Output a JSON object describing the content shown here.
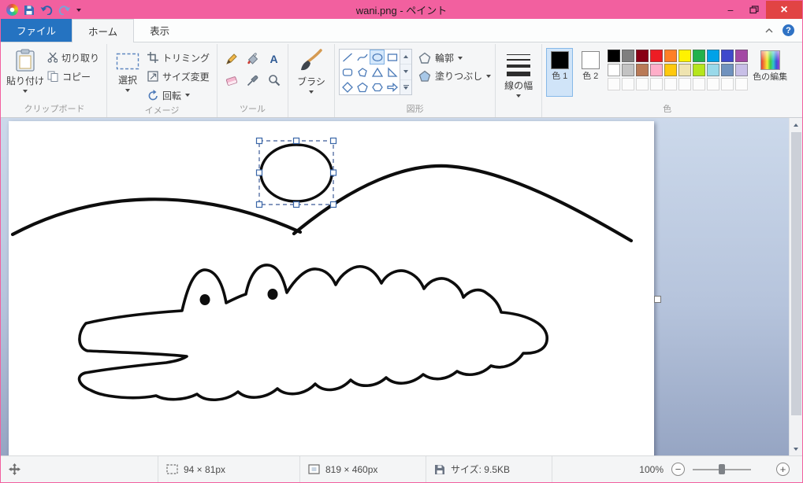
{
  "theme": {
    "titlebar_color": "#f2609f",
    "close_button_color": "#e14444",
    "file_tab_color": "#2573c1",
    "selection_highlight": "#d5e8fb",
    "canvas_bg_top": "#ccd9eb",
    "canvas_bg_bottom": "#96a5c3"
  },
  "window": {
    "title": "wani.png - ペイント",
    "minimize": "−",
    "close": "×"
  },
  "help": "?",
  "tabs": {
    "file": "ファイル",
    "home": "ホーム",
    "view": "表示"
  },
  "ribbon": {
    "clipboard": {
      "group_label": "クリップボード",
      "paste": "貼り付け",
      "cut": "切り取り",
      "copy": "コピー"
    },
    "image": {
      "group_label": "イメージ",
      "select": "選択",
      "crop": "トリミング",
      "resize": "サイズ変更",
      "rotate": "回転"
    },
    "tools": {
      "group_label": "ツール"
    },
    "brushes": {
      "brush": "ブラシ"
    },
    "shapes": {
      "group_label": "図形",
      "outline": "輪郭",
      "fill": "塗りつぶし"
    },
    "size": {
      "line_width": "線の幅"
    },
    "colors": {
      "group_label": "色",
      "color1_label": "色 1",
      "color2_label": "色 2",
      "edit_colors": "色の編集",
      "color1": "#000000",
      "color2": "#ffffff",
      "palette_row1": [
        "#000000",
        "#7f7f7f",
        "#880015",
        "#ed1c24",
        "#ff7f27",
        "#fff200",
        "#22b14c",
        "#00a2e8",
        "#3f48cc",
        "#a349a4"
      ],
      "palette_row2": [
        "#ffffff",
        "#c3c3c3",
        "#b97a57",
        "#ffaec9",
        "#ffc90e",
        "#efe4b0",
        "#b5e61d",
        "#99d9ea",
        "#7092be",
        "#c8bfe7"
      ],
      "palette_row3": [
        "",
        "",
        "",
        "",
        "",
        "",
        "",
        "",
        "",
        ""
      ]
    }
  },
  "statusbar": {
    "selection_size": "94 × 81px",
    "canvas_size": "819 × 460px",
    "file_size": "サイズ: 9.5KB",
    "zoom": "100%"
  }
}
